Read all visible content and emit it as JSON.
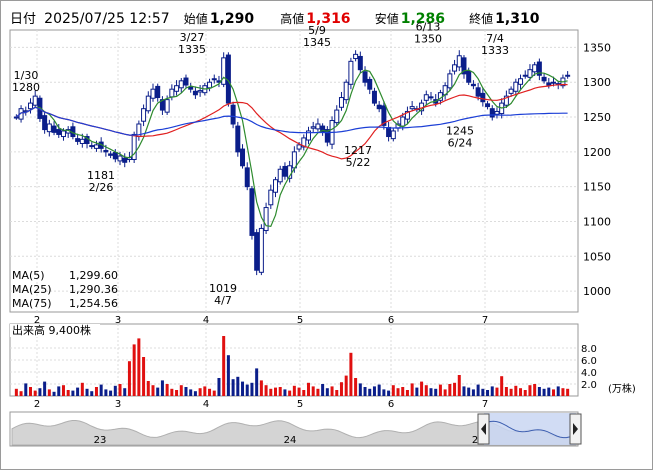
{
  "header": {
    "datetime_label": "日付",
    "datetime": "2025/07/25 12:57",
    "open_label": "始値",
    "open": "1,290",
    "high_label": "高値",
    "high": "1,316",
    "low_label": "安値",
    "low": "1,286",
    "close_label": "終値",
    "close": "1,310",
    "high_color": "#e00000",
    "low_color": "#008000"
  },
  "chart_data": {
    "type": "line",
    "title": "",
    "ylim": [
      970,
      1375
    ],
    "y_ticks": [
      1000,
      1050,
      1100,
      1150,
      1200,
      1250,
      1300,
      1350
    ],
    "x_month_labels": [
      "2",
      "3",
      "4",
      "5",
      "6",
      "7"
    ],
    "series": [
      {
        "name": "MA(5)",
        "color": "#2e8b2e"
      },
      {
        "name": "MA(25)",
        "color": "#e02020"
      },
      {
        "name": "MA(75)",
        "color": "#1c3fd6"
      }
    ],
    "ma_legend": [
      {
        "label": "MA(5)",
        "value": "1,299.60",
        "color": "#2e8b2e"
      },
      {
        "label": "MA(25)",
        "value": "1,290.36",
        "color": "#e02020"
      },
      {
        "label": "MA(75)",
        "value": "1,254.56",
        "color": "#1c3fd6"
      }
    ],
    "annotations": [
      {
        "date": "1/30",
        "value": 1280,
        "date_text": "1/30",
        "value_text": "1280",
        "pos": "above"
      },
      {
        "date": "2/26",
        "value": 1181,
        "date_text": "2/26",
        "value_text": "1181",
        "pos": "below"
      },
      {
        "date": "3/27",
        "value": 1335,
        "date_text": "3/27",
        "value_text": "1335",
        "pos": "above"
      },
      {
        "date": "4/7",
        "value": 1019,
        "date_text": "4/7",
        "value_text": "1019",
        "pos": "below"
      },
      {
        "date": "5/9",
        "value": 1345,
        "date_text": "5/9",
        "value_text": "1345",
        "pos": "above"
      },
      {
        "date": "5/22",
        "value": 1217,
        "date_text": "5/22",
        "value_text": "1217",
        "pos": "below"
      },
      {
        "date": "6/13",
        "value": 1350,
        "date_text": "6/13",
        "value_text": "1350",
        "pos": "above"
      },
      {
        "date": "6/24",
        "value": 1245,
        "date_text": "6/24",
        "value_text": "1245",
        "pos": "below"
      },
      {
        "date": "7/4",
        "value": 1333,
        "date_text": "7/4",
        "value_text": "1333",
        "pos": "above"
      }
    ],
    "close_approx": [
      1250,
      1262,
      1258,
      1270,
      1280,
      1248,
      1232,
      1240,
      1228,
      1225,
      1230,
      1232,
      1222,
      1215,
      1218,
      1212,
      1208,
      1210,
      1205,
      1200,
      1195,
      1190,
      1194,
      1185,
      1192,
      1225,
      1240,
      1262,
      1280,
      1290,
      1278,
      1260,
      1275,
      1290,
      1295,
      1302,
      1296,
      1290,
      1282,
      1288,
      1295,
      1300,
      1305,
      1300,
      1335,
      1270,
      1240,
      1200,
      1180,
      1150,
      1080,
      1030,
      1090,
      1120,
      1145,
      1160,
      1175,
      1165,
      1180,
      1200,
      1210,
      1220,
      1230,
      1236,
      1240,
      1228,
      1214,
      1245,
      1260,
      1278,
      1300,
      1330,
      1340,
      1318,
      1300,
      1290,
      1270,
      1262,
      1238,
      1222,
      1230,
      1240,
      1250,
      1258,
      1265,
      1262,
      1270,
      1282,
      1278,
      1270,
      1285,
      1295,
      1312,
      1325,
      1338,
      1312,
      1300,
      1295,
      1280,
      1272,
      1265,
      1250,
      1258,
      1270,
      1280,
      1290,
      1300,
      1305,
      1310,
      1318,
      1325,
      1310,
      1302,
      1296,
      1300,
      1298,
      1306,
      1310
    ],
    "volume": {
      "label": "出来高",
      "last": "9,400株",
      "unit": "(万株)",
      "ylim": [
        0,
        10
      ],
      "ticks": [
        2.0,
        4.0,
        6.0,
        8.0
      ],
      "values": [
        1.2,
        0.8,
        2.1,
        1.5,
        0.9,
        1.3,
        2.4,
        1.1,
        0.7,
        1.6,
        1.8,
        1.0,
        0.9,
        1.4,
        2.2,
        1.2,
        0.8,
        1.5,
        1.9,
        1.1,
        0.9,
        1.7,
        2.0,
        1.3,
        5.8,
        8.6,
        9.6,
        6.5,
        2.5,
        1.8,
        1.4,
        2.6,
        2.0,
        1.2,
        1.0,
        1.8,
        1.5,
        1.1,
        0.8,
        1.3,
        1.6,
        1.2,
        0.9,
        3.0,
        10.0,
        6.8,
        2.8,
        3.2,
        2.4,
        1.9,
        2.2,
        4.6,
        2.6,
        1.8,
        1.2,
        1.4,
        1.5,
        1.1,
        0.9,
        1.7,
        1.4,
        1.0,
        2.2,
        1.6,
        1.2,
        2.0,
        1.3,
        1.6,
        1.0,
        2.3,
        3.4,
        7.2,
        3.0,
        2.1,
        1.5,
        1.2,
        1.6,
        1.9,
        1.1,
        0.9,
        1.8,
        1.3,
        1.5,
        1.0,
        2.1,
        1.4,
        2.4,
        1.8,
        1.3,
        1.2,
        1.9,
        1.1,
        2.0,
        2.2,
        3.5,
        1.6,
        1.4,
        1.1,
        1.9,
        1.2,
        1.0,
        1.6,
        1.4,
        3.3,
        1.5,
        1.2,
        1.7,
        1.3,
        1.0,
        1.8,
        2.0,
        1.5,
        1.2,
        1.4,
        1.1,
        1.6,
        1.3,
        1.2
      ]
    }
  },
  "navigator": {
    "labels": [
      "23",
      "24",
      "2"
    ]
  }
}
